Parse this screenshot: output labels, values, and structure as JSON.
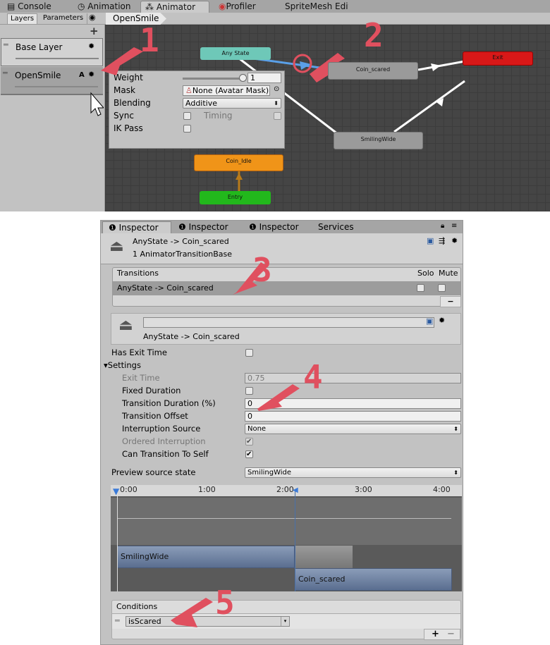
{
  "animator_window": {
    "tabs": [
      {
        "label": "Console",
        "icon": "console-icon"
      },
      {
        "label": "Animation",
        "icon": "clock-icon"
      },
      {
        "label": "Animator",
        "icon": "animator-icon",
        "active": true
      },
      {
        "label": "Profiler",
        "icon": "profiler-icon"
      },
      {
        "label": "SpriteMesh Edit"
      }
    ],
    "subtabs": {
      "layers": "Layers",
      "parameters": "Parameters"
    },
    "breadcrumb": "OpenSmile",
    "add_label": "+",
    "layers": [
      {
        "name": "Base Layer"
      },
      {
        "name": "OpenSmile",
        "badge": "A",
        "selected": true
      }
    ],
    "layer_settings": {
      "weight_label": "Weight",
      "weight_value": "1",
      "weight_fraction": 1.0,
      "mask_label": "Mask",
      "mask_value": "None (Avatar Mask)",
      "blending_label": "Blending",
      "blending_value": "Additive",
      "sync_label": "Sync",
      "timing_label": "Timing",
      "ik_label": "IK Pass"
    },
    "states": {
      "any": "Any State",
      "coin_scared": "Coin_scared",
      "exit": "Exit",
      "smiling": "SmilingWide",
      "coin_idle": "Coin_Idle",
      "entry": "Entry"
    },
    "colors": {
      "any": "#6ec8b8",
      "exit": "#d81818",
      "default": "#f09418",
      "entry": "#22b81c",
      "state": "#9a9a9a",
      "selected_transition": "#5aa0e8",
      "annotation": "#e0505f"
    }
  },
  "annotations": [
    "1",
    "2",
    "3",
    "4",
    "5"
  ],
  "inspector": {
    "tabs": [
      "Inspector",
      "Inspector",
      "Inspector",
      "Services"
    ],
    "title": "AnyState -> Coin_scared",
    "subtitle": "1 AnimatorTransitionBase",
    "transitions": {
      "header": "Transitions",
      "solo": "Solo",
      "mute": "Mute",
      "items": [
        "AnyState -> Coin_scared"
      ],
      "remove": "−"
    },
    "transition_name": "AnyState -> Coin_scared",
    "has_exit_time": {
      "label": "Has Exit Time",
      "checked": false
    },
    "settings_label": "Settings",
    "exit_time": {
      "label": "Exit Time",
      "value": "0.75"
    },
    "fixed_duration": {
      "label": "Fixed Duration",
      "checked": false
    },
    "transition_duration": {
      "label": "Transition Duration (%)",
      "value": "0"
    },
    "transition_offset": {
      "label": "Transition Offset",
      "value": "0"
    },
    "interruption_source": {
      "label": "Interruption Source",
      "value": "None"
    },
    "ordered_interruption": {
      "label": "Ordered Interruption",
      "checked": true
    },
    "can_transition_to_self": {
      "label": "Can Transition To Self",
      "checked": true
    },
    "preview_source": {
      "label": "Preview source state",
      "value": "SmilingWide"
    },
    "timeline": {
      "ticks": [
        "0:00",
        "1:00",
        "2:00",
        "3:00",
        "4:00"
      ],
      "source": "SmilingWide",
      "destination": "Coin_scared",
      "source_range": [
        0,
        2.27
      ],
      "transition_range": [
        2.27,
        3.0
      ],
      "destination_range": [
        2.27,
        4.27
      ]
    },
    "conditions": {
      "header": "Conditions",
      "items": [
        {
          "param": "isScared"
        }
      ],
      "add": "+",
      "remove": "−"
    }
  }
}
